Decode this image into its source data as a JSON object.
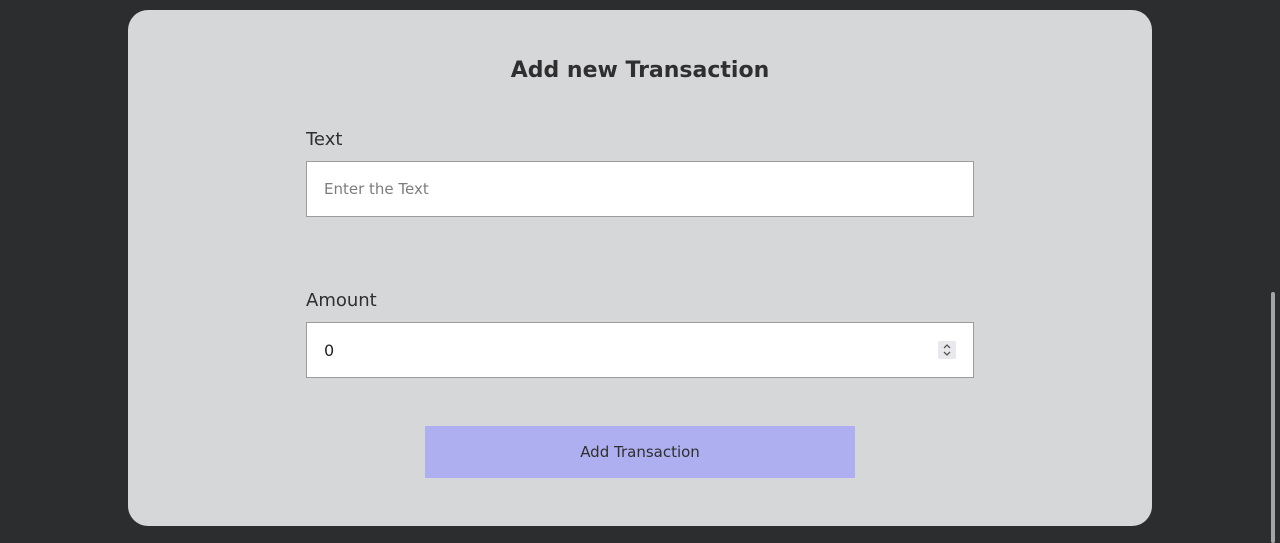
{
  "form": {
    "title": "Add new Transaction",
    "text_field": {
      "label": "Text",
      "placeholder": "Enter the Text",
      "value": ""
    },
    "amount_field": {
      "label": "Amount",
      "value": "0"
    },
    "submit_label": "Add Transaction"
  },
  "colors": {
    "background": "#2c2d2f",
    "card": "#d6d7d9",
    "button": "#aeaff0"
  },
  "icons": {
    "spinner": "number-spinner-icon"
  }
}
